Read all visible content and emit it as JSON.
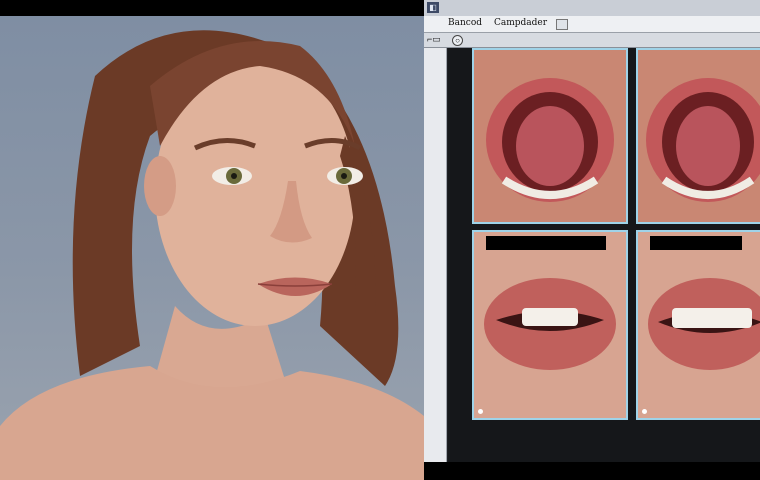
{
  "menubar": {
    "items": [
      "Bancod",
      "Campdader"
    ]
  },
  "colors": {
    "tile_border": "#9fd3e8",
    "background_gray": "#8b97a8",
    "lip_red": "#c0605c"
  },
  "icons": {
    "app": "app-icon",
    "toolbar_toggle": "circle-icon"
  }
}
